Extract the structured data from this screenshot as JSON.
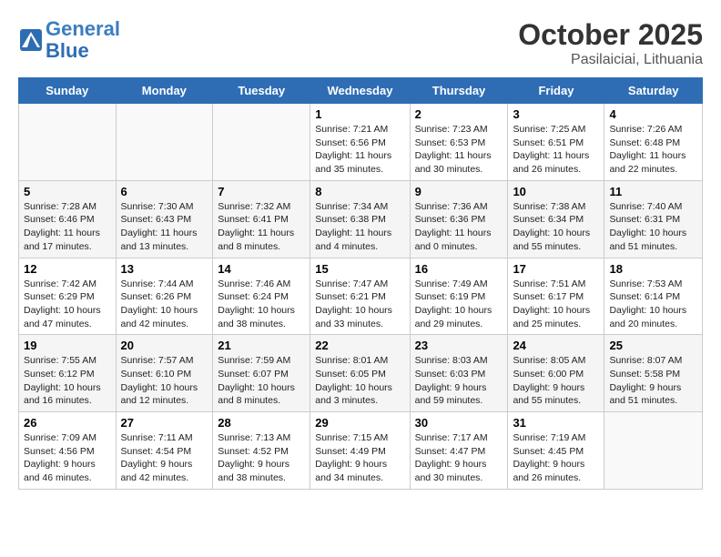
{
  "header": {
    "logo_line1": "General",
    "logo_line2": "Blue",
    "month": "October 2025",
    "location": "Pasilaiciai, Lithuania"
  },
  "weekdays": [
    "Sunday",
    "Monday",
    "Tuesday",
    "Wednesday",
    "Thursday",
    "Friday",
    "Saturday"
  ],
  "weeks": [
    [
      {
        "day": "",
        "info": ""
      },
      {
        "day": "",
        "info": ""
      },
      {
        "day": "",
        "info": ""
      },
      {
        "day": "1",
        "info": "Sunrise: 7:21 AM\nSunset: 6:56 PM\nDaylight: 11 hours and 35 minutes."
      },
      {
        "day": "2",
        "info": "Sunrise: 7:23 AM\nSunset: 6:53 PM\nDaylight: 11 hours and 30 minutes."
      },
      {
        "day": "3",
        "info": "Sunrise: 7:25 AM\nSunset: 6:51 PM\nDaylight: 11 hours and 26 minutes."
      },
      {
        "day": "4",
        "info": "Sunrise: 7:26 AM\nSunset: 6:48 PM\nDaylight: 11 hours and 22 minutes."
      }
    ],
    [
      {
        "day": "5",
        "info": "Sunrise: 7:28 AM\nSunset: 6:46 PM\nDaylight: 11 hours and 17 minutes."
      },
      {
        "day": "6",
        "info": "Sunrise: 7:30 AM\nSunset: 6:43 PM\nDaylight: 11 hours and 13 minutes."
      },
      {
        "day": "7",
        "info": "Sunrise: 7:32 AM\nSunset: 6:41 PM\nDaylight: 11 hours and 8 minutes."
      },
      {
        "day": "8",
        "info": "Sunrise: 7:34 AM\nSunset: 6:38 PM\nDaylight: 11 hours and 4 minutes."
      },
      {
        "day": "9",
        "info": "Sunrise: 7:36 AM\nSunset: 6:36 PM\nDaylight: 11 hours and 0 minutes."
      },
      {
        "day": "10",
        "info": "Sunrise: 7:38 AM\nSunset: 6:34 PM\nDaylight: 10 hours and 55 minutes."
      },
      {
        "day": "11",
        "info": "Sunrise: 7:40 AM\nSunset: 6:31 PM\nDaylight: 10 hours and 51 minutes."
      }
    ],
    [
      {
        "day": "12",
        "info": "Sunrise: 7:42 AM\nSunset: 6:29 PM\nDaylight: 10 hours and 47 minutes."
      },
      {
        "day": "13",
        "info": "Sunrise: 7:44 AM\nSunset: 6:26 PM\nDaylight: 10 hours and 42 minutes."
      },
      {
        "day": "14",
        "info": "Sunrise: 7:46 AM\nSunset: 6:24 PM\nDaylight: 10 hours and 38 minutes."
      },
      {
        "day": "15",
        "info": "Sunrise: 7:47 AM\nSunset: 6:21 PM\nDaylight: 10 hours and 33 minutes."
      },
      {
        "day": "16",
        "info": "Sunrise: 7:49 AM\nSunset: 6:19 PM\nDaylight: 10 hours and 29 minutes."
      },
      {
        "day": "17",
        "info": "Sunrise: 7:51 AM\nSunset: 6:17 PM\nDaylight: 10 hours and 25 minutes."
      },
      {
        "day": "18",
        "info": "Sunrise: 7:53 AM\nSunset: 6:14 PM\nDaylight: 10 hours and 20 minutes."
      }
    ],
    [
      {
        "day": "19",
        "info": "Sunrise: 7:55 AM\nSunset: 6:12 PM\nDaylight: 10 hours and 16 minutes."
      },
      {
        "day": "20",
        "info": "Sunrise: 7:57 AM\nSunset: 6:10 PM\nDaylight: 10 hours and 12 minutes."
      },
      {
        "day": "21",
        "info": "Sunrise: 7:59 AM\nSunset: 6:07 PM\nDaylight: 10 hours and 8 minutes."
      },
      {
        "day": "22",
        "info": "Sunrise: 8:01 AM\nSunset: 6:05 PM\nDaylight: 10 hours and 3 minutes."
      },
      {
        "day": "23",
        "info": "Sunrise: 8:03 AM\nSunset: 6:03 PM\nDaylight: 9 hours and 59 minutes."
      },
      {
        "day": "24",
        "info": "Sunrise: 8:05 AM\nSunset: 6:00 PM\nDaylight: 9 hours and 55 minutes."
      },
      {
        "day": "25",
        "info": "Sunrise: 8:07 AM\nSunset: 5:58 PM\nDaylight: 9 hours and 51 minutes."
      }
    ],
    [
      {
        "day": "26",
        "info": "Sunrise: 7:09 AM\nSunset: 4:56 PM\nDaylight: 9 hours and 46 minutes."
      },
      {
        "day": "27",
        "info": "Sunrise: 7:11 AM\nSunset: 4:54 PM\nDaylight: 9 hours and 42 minutes."
      },
      {
        "day": "28",
        "info": "Sunrise: 7:13 AM\nSunset: 4:52 PM\nDaylight: 9 hours and 38 minutes."
      },
      {
        "day": "29",
        "info": "Sunrise: 7:15 AM\nSunset: 4:49 PM\nDaylight: 9 hours and 34 minutes."
      },
      {
        "day": "30",
        "info": "Sunrise: 7:17 AM\nSunset: 4:47 PM\nDaylight: 9 hours and 30 minutes."
      },
      {
        "day": "31",
        "info": "Sunrise: 7:19 AM\nSunset: 4:45 PM\nDaylight: 9 hours and 26 minutes."
      },
      {
        "day": "",
        "info": ""
      }
    ]
  ]
}
